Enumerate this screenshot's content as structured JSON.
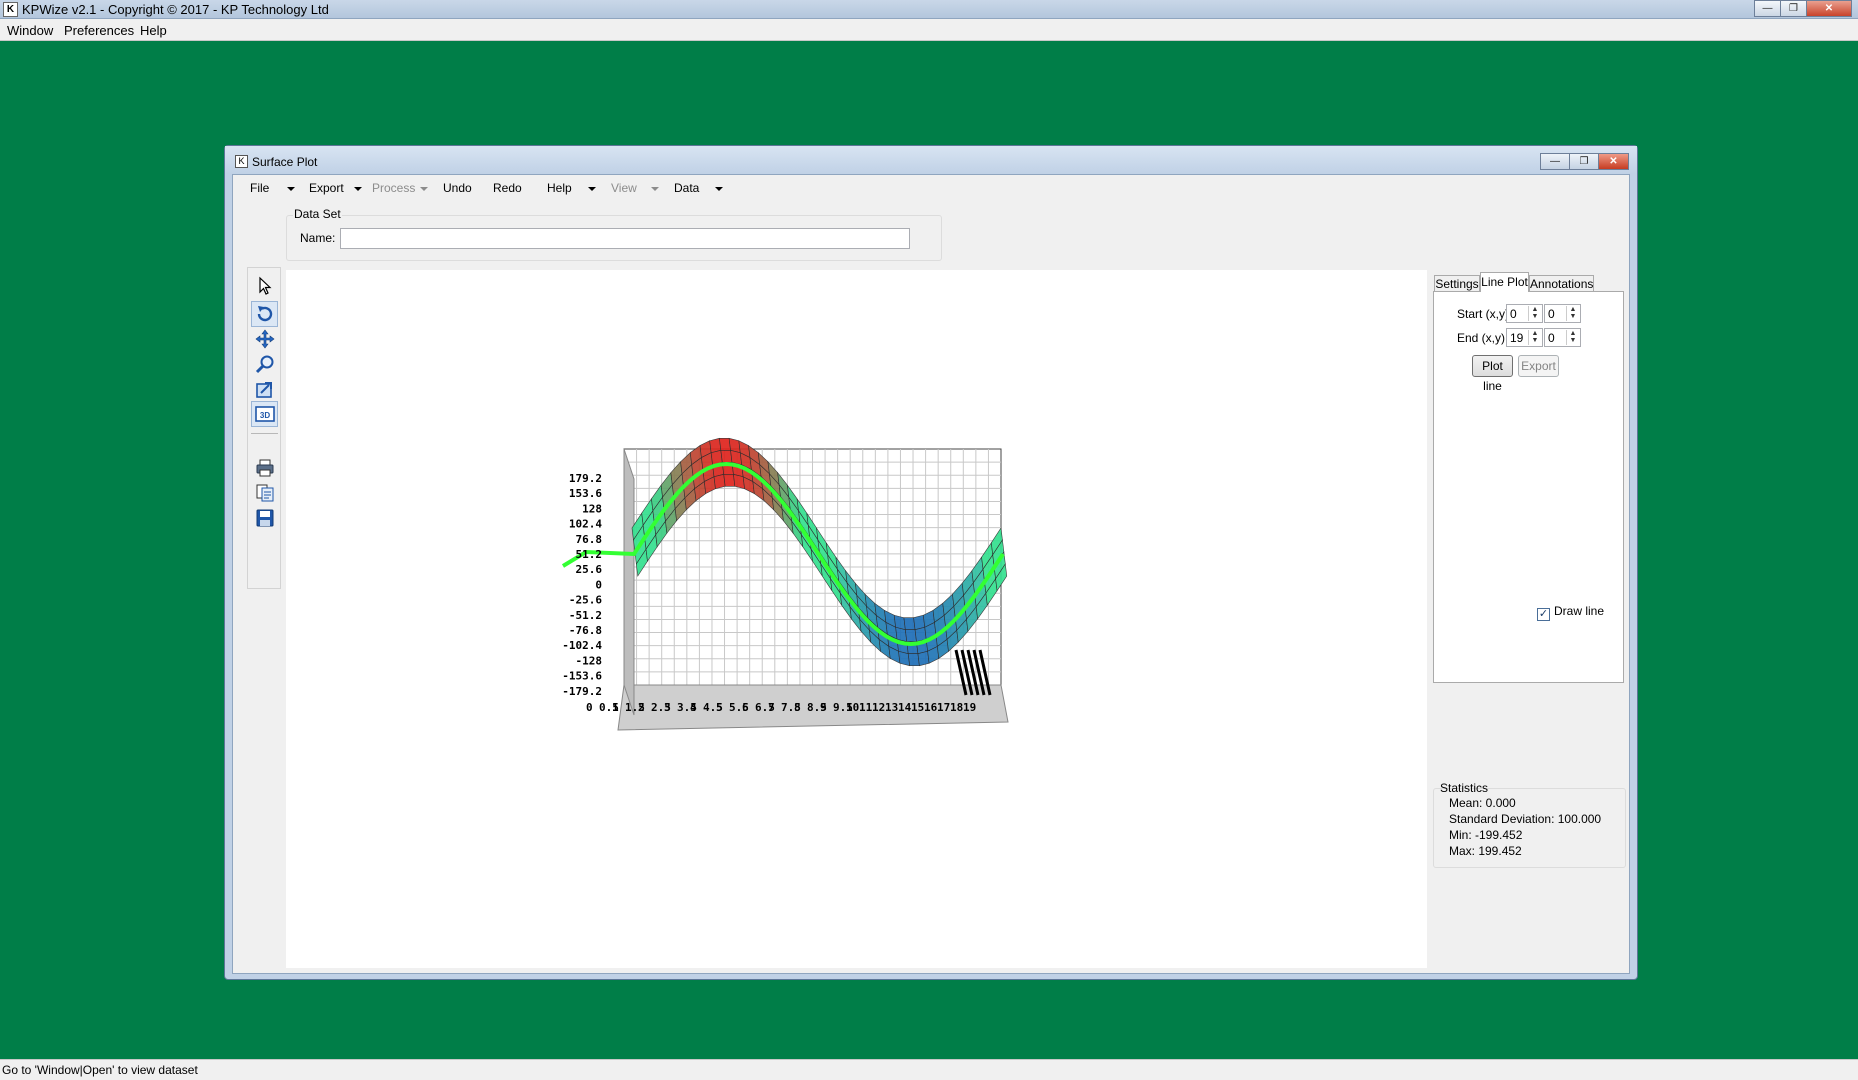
{
  "app": {
    "title": "KPWize v2.1 - Copyright © 2017 - KP Technology Ltd",
    "icon": "app-logo-icon",
    "menu": [
      "Window",
      "Preferences",
      "Help"
    ],
    "status": "Go to 'Window|Open' to view dataset",
    "background_color": "#007e48"
  },
  "window": {
    "title": "Surface Plot",
    "menu": {
      "file": "File",
      "export": "Export",
      "process": "Process",
      "undo": "Undo",
      "redo": "Redo",
      "help": "Help",
      "view": "View",
      "data": "Data"
    },
    "dataset": {
      "legend": "Data Set",
      "name_label": "Name:",
      "name_value": ""
    },
    "tools": [
      "select-arrow-icon",
      "rotate-icon",
      "pan-icon",
      "zoom-icon",
      "zoom-box-icon",
      "3d-view-icon",
      "print-icon",
      "copy-icon",
      "save-icon"
    ]
  },
  "panel": {
    "tabs": {
      "settings": "Settings",
      "lineplot": "Line Plot",
      "annotations": "Annotations"
    },
    "start_label": "Start (x,y):",
    "end_label": "End (x,y):",
    "start_x": "0",
    "start_y": "0",
    "end_x": "19",
    "end_y": "0",
    "plot_line": "Plot line",
    "export": "Export",
    "draw_line": "Draw line",
    "draw_line_checked": true
  },
  "stats": {
    "legend": "Statistics",
    "mean": "Mean: 0.000",
    "std": "Standard Deviation: 100.000",
    "min": "Min: -199.452",
    "max": "Max: 199.452"
  },
  "chart_data": {
    "type": "surface",
    "y_ticks": [
      "179.2",
      "153.6",
      "128",
      "102.4",
      "76.8",
      "51.2",
      "25.6",
      "0",
      "-25.6",
      "-51.2",
      "-76.8",
      "-102.4",
      "-128",
      "-153.6",
      "-179.2"
    ],
    "x_ticks": [
      "0",
      "0.5",
      "1",
      "1.5",
      "2",
      "2.5",
      "3",
      "3.5",
      "4",
      "4.5",
      "5",
      "5.5",
      "6",
      "6.5",
      "7",
      "7.5",
      "8",
      "8.5",
      "9",
      "9.5",
      "10",
      "11",
      "12",
      "13",
      "14",
      "15",
      "16",
      "17",
      "18",
      "19"
    ],
    "x_range": [
      0,
      19
    ],
    "z_range": [
      -199.452,
      199.452
    ],
    "surface": "z = 199.452 * sin(2*pi*x/19)",
    "line_plot": {
      "start": [
        0,
        0
      ],
      "end": [
        19,
        0
      ],
      "color": "#33ff33"
    },
    "colors": {
      "high": "#e0221c",
      "mid": "#2fe28c",
      "low": "#1e6fb8"
    },
    "grid": true
  }
}
